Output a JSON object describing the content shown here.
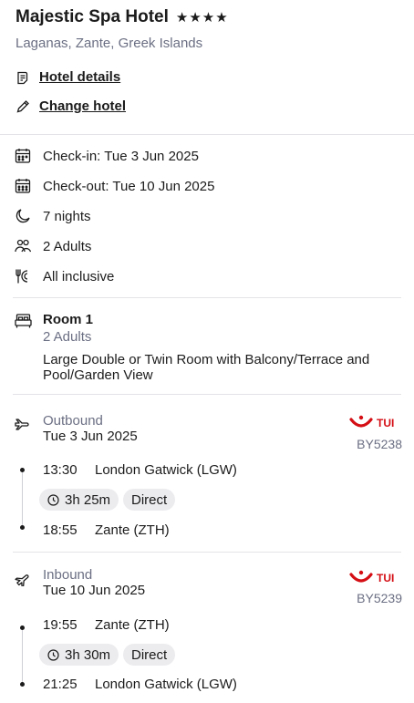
{
  "hotel": {
    "name": "Majestic Spa Hotel",
    "stars": "★★★★",
    "location": "Laganas, Zante, Greek Islands",
    "details_link": "Hotel details",
    "change_link": "Change hotel"
  },
  "summary": {
    "checkin": "Check-in: Tue 3 Jun 2025",
    "checkout": "Check-out: Tue 10 Jun 2025",
    "nights": "7 nights",
    "guests": "2 Adults",
    "board": "All inclusive"
  },
  "room": {
    "title": "Room 1",
    "occupancy": "2 Adults",
    "description": "Large Double or Twin Room with Balcony/Terrace and Pool/Garden View"
  },
  "outbound": {
    "direction": "Outbound",
    "date": "Tue 3 Jun 2025",
    "airline": "TUI",
    "flight_number": "BY5238",
    "depart_time": "13:30",
    "depart_place": "London Gatwick (LGW)",
    "duration": "3h 25m",
    "stops": "Direct",
    "arrive_time": "18:55",
    "arrive_place": "Zante (ZTH)"
  },
  "inbound": {
    "direction": "Inbound",
    "date": "Tue 10 Jun 2025",
    "airline": "TUI",
    "flight_number": "BY5239",
    "depart_time": "19:55",
    "depart_place": "Zante (ZTH)",
    "duration": "3h 30m",
    "stops": "Direct",
    "arrive_time": "21:25",
    "arrive_place": "London Gatwick (LGW)"
  },
  "colors": {
    "brand_red": "#d40e14",
    "muted_text": "#6b6f83",
    "pill_bg": "#ececef"
  }
}
